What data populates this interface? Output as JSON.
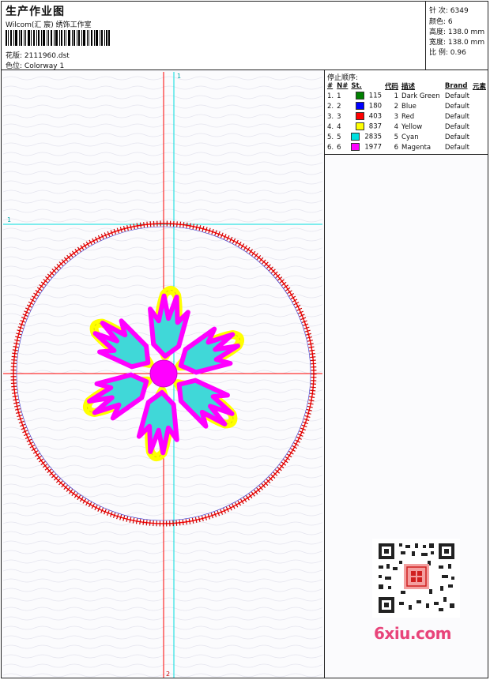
{
  "header": {
    "title": "生产作业图",
    "company": "Wilcom(汇 宸) 绣饰工作室",
    "design_label": "花版:",
    "design_value": "2111960.dst",
    "colorway_label": "色位:",
    "colorway_value": "Colorway 1"
  },
  "stats": {
    "stitches_label": "针 次:",
    "stitches_value": "6349",
    "colors_label": "颜色:",
    "colors_value": "6",
    "height_label": "高度:",
    "height_value": "138.0 mm",
    "width_label": "宽度:",
    "width_value": "138.0 mm",
    "scale_label": "比 例:",
    "scale_value": "0.96"
  },
  "stop_sequence": {
    "title": "停止顺序:",
    "columns": [
      "#",
      "N#",
      "St.",
      "代码",
      "描述",
      "Brand",
      "元素"
    ],
    "rows": [
      {
        "idx": "1.",
        "n": "1",
        "color": "#008000",
        "st": "115",
        "code": "1",
        "desc": "Dark Green",
        "brand": "Default",
        "elem": ""
      },
      {
        "idx": "2.",
        "n": "2",
        "color": "#0000ff",
        "st": "180",
        "code": "2",
        "desc": "Blue",
        "brand": "Default",
        "elem": ""
      },
      {
        "idx": "3.",
        "n": "3",
        "color": "#ff0000",
        "st": "403",
        "code": "3",
        "desc": "Red",
        "brand": "Default",
        "elem": ""
      },
      {
        "idx": "4.",
        "n": "4",
        "color": "#ffff00",
        "st": "837",
        "code": "4",
        "desc": "Yellow",
        "brand": "Default",
        "elem": ""
      },
      {
        "idx": "5.",
        "n": "5",
        "color": "#00e0e0",
        "st": "2835",
        "code": "5",
        "desc": "Cyan",
        "brand": "Default",
        "elem": ""
      },
      {
        "idx": "6.",
        "n": "6",
        "color": "#ff00ff",
        "st": "1977",
        "code": "6",
        "desc": "Magenta",
        "brand": "Default",
        "elem": ""
      }
    ]
  },
  "canvas": {
    "marker_top": "1",
    "marker_left": "1",
    "marker_bottom": "2",
    "colors": {
      "red": "#ff0000",
      "cyan": "#00e0e0",
      "yellow": "#ffff00",
      "magenta": "#ff00ff",
      "teal": "#40d8d8"
    }
  },
  "watermark": {
    "text": "6xiu.com",
    "color": "#e8447a"
  }
}
